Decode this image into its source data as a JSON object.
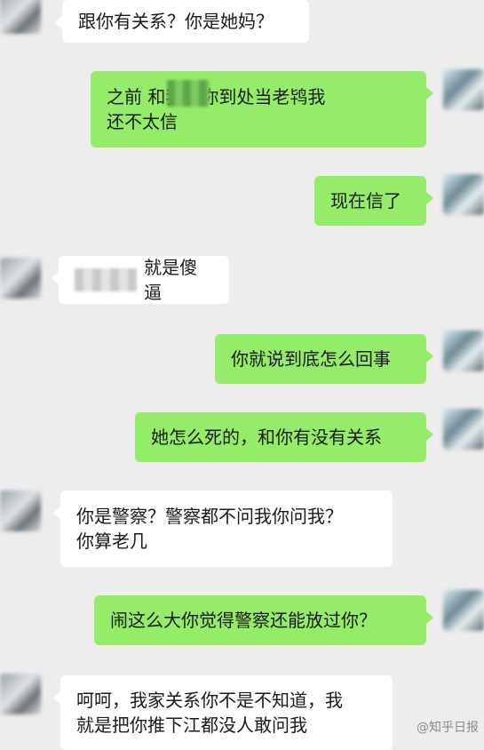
{
  "messages": [
    {
      "side": "in",
      "text": "跟你有关系？你是她妈？"
    },
    {
      "side": "out",
      "text": "之前    和我说你到处当老鸨我\n还不太信"
    },
    {
      "side": "out",
      "text": "现在信了"
    },
    {
      "side": "in",
      "text": "就是傻逼"
    },
    {
      "side": "out",
      "text": "你就说到底怎么回事"
    },
    {
      "side": "out",
      "text": "她怎么死的，和你有没有关系"
    },
    {
      "side": "in",
      "text": "你是警察？警察都不问我你问我？\n你算老几"
    },
    {
      "side": "out",
      "text": "闹这么大你觉得警察还能放过你？"
    },
    {
      "side": "in",
      "text": "呵呵，我家关系你不是不知道，我\n就是把你推下江都没人敢问我"
    }
  ],
  "watermark": "@知乎日报"
}
